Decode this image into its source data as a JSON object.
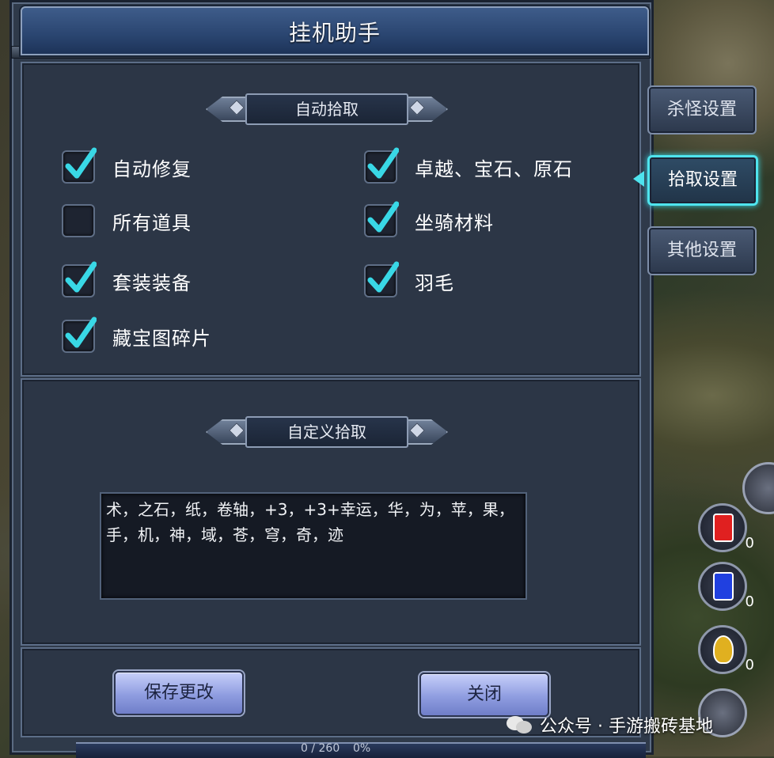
{
  "window": {
    "title": "挂机助手"
  },
  "auto_pickup": {
    "section_title": "自动拾取",
    "options": [
      {
        "label": "自动修复",
        "checked": true
      },
      {
        "label": "卓越、宝石、原石",
        "checked": true
      },
      {
        "label": "所有道具",
        "checked": false
      },
      {
        "label": "坐骑材料",
        "checked": true
      },
      {
        "label": "套装装备",
        "checked": true
      },
      {
        "label": "羽毛",
        "checked": true
      },
      {
        "label": "藏宝图碎片",
        "checked": true
      }
    ]
  },
  "custom_pickup": {
    "section_title": "自定义拾取",
    "text": "术，之石，纸，卷轴，+3，+3+幸运，华，为，苹，果，手，机，神，域，苍，穹，奇，迹"
  },
  "buttons": {
    "save": "保存更改",
    "close": "关闭"
  },
  "side_tabs": [
    {
      "label": "杀怪设置",
      "active": false
    },
    {
      "label": "拾取设置",
      "active": true
    },
    {
      "label": "其他设置",
      "active": false
    }
  ],
  "potions": [
    {
      "icon": "red-potion-icon",
      "count": "0",
      "color": "#e02020"
    },
    {
      "icon": "blue-potion-icon",
      "count": "0",
      "color": "#2040e0"
    },
    {
      "icon": "yellow-potion-icon",
      "count": "0",
      "color": "#e0b020"
    }
  ],
  "status_bar": {
    "exp": "0 / 260",
    "percent": "0%"
  },
  "watermark": "公众号 · 手游搬砖基地",
  "colors": {
    "accent": "#4fe4ee",
    "check": "#39d8e6"
  }
}
